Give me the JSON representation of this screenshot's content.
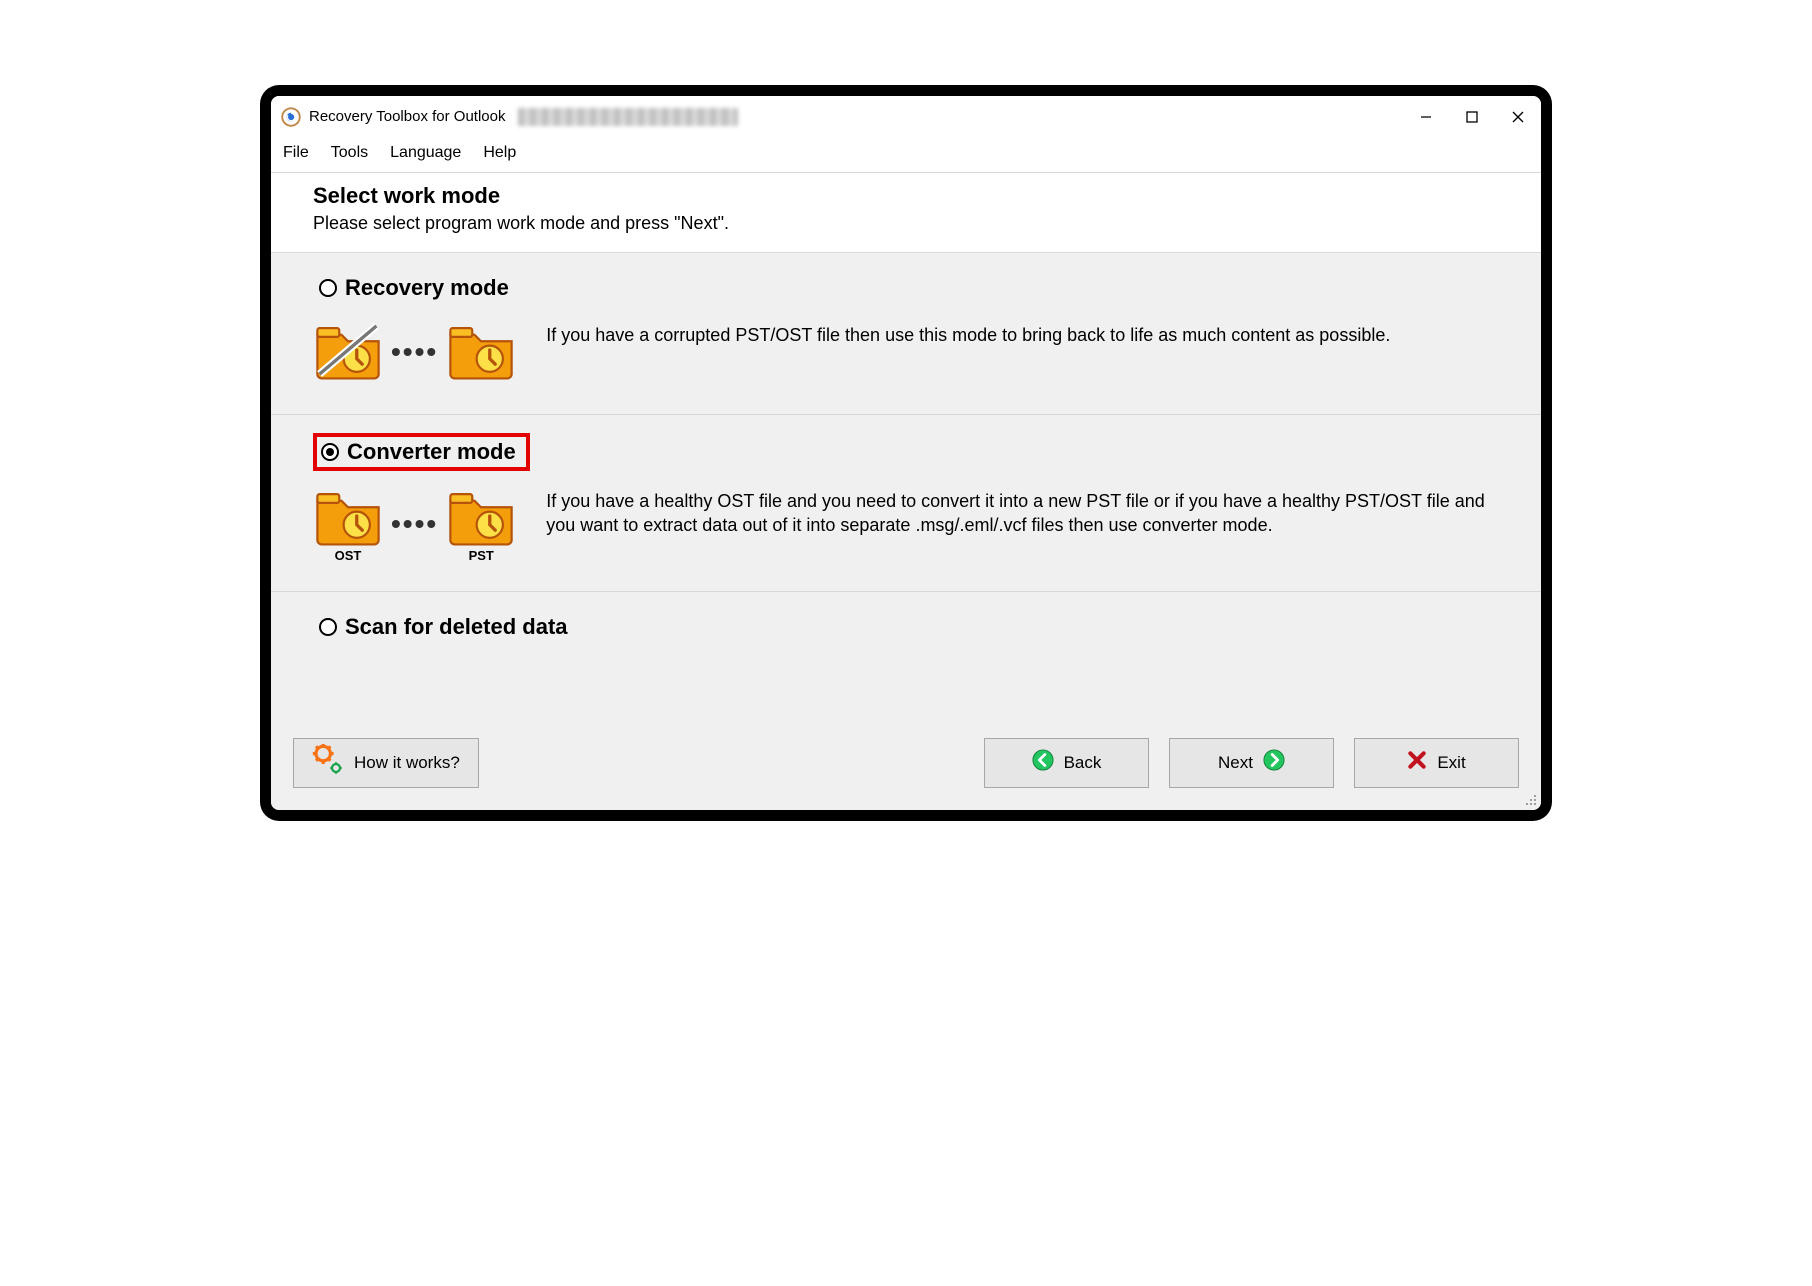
{
  "titlebar": {
    "app_title": "Recovery Toolbox for Outlook"
  },
  "menubar": {
    "file": "File",
    "tools": "Tools",
    "language": "Language",
    "help": "Help"
  },
  "header": {
    "title": "Select work mode",
    "subtitle": "Please select program work mode and press \"Next\"."
  },
  "modes": {
    "recovery": {
      "label": "Recovery mode",
      "selected": false,
      "desc": "If you have a corrupted PST/OST file then use this mode to bring back to life as much content as possible."
    },
    "converter": {
      "label": "Converter mode",
      "selected": true,
      "highlighted": true,
      "desc": "If you have a healthy OST file and you need to convert it into a new PST file or if you have a healthy PST/OST file and you want to extract data out of it into separate .msg/.eml/.vcf files then use converter mode.",
      "left_caption": "OST",
      "right_caption": "PST"
    },
    "scan": {
      "label": "Scan for deleted data",
      "selected": false
    }
  },
  "footer": {
    "how_it_works": "How it works?",
    "back": "Back",
    "next": "Next",
    "exit": "Exit"
  }
}
